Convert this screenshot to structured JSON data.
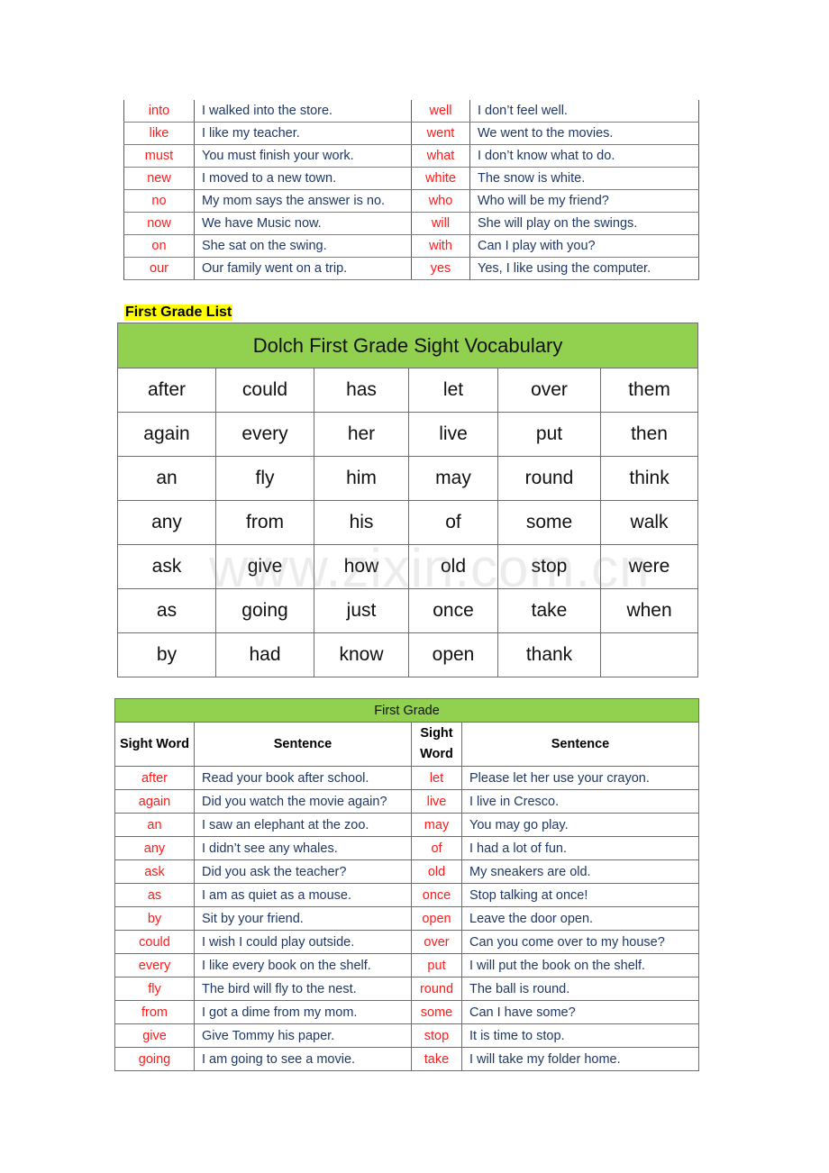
{
  "top_table": {
    "rows": [
      {
        "w1": "into",
        "s1": "I walked into the store.",
        "w2": "well",
        "s2": "I don’t feel well."
      },
      {
        "w1": "like",
        "s1": "I like my teacher.",
        "w2": "went",
        "s2": "We went to the movies."
      },
      {
        "w1": "must",
        "s1": "You must finish your work.",
        "w2": "what",
        "s2": "I don’t know what to do."
      },
      {
        "w1": "new",
        "s1": "I moved to a new town.",
        "w2": "white",
        "s2": "The snow is white."
      },
      {
        "w1": "no",
        "s1": "My mom says the answer is no.",
        "w2": "who",
        "s2": "Who will be my friend?"
      },
      {
        "w1": "now",
        "s1": "We have Music now.",
        "w2": "will",
        "s2": "She will play on the swings."
      },
      {
        "w1": "on",
        "s1": "She sat on the swing.",
        "w2": "with",
        "s2": "Can I play with you?"
      },
      {
        "w1": "our",
        "s1": "Our family went on a trip.",
        "w2": "yes",
        "s2": "Yes, I like using the computer."
      }
    ]
  },
  "heading": "First Grade List",
  "dolch_grid": {
    "title": "Dolch First Grade Sight Vocabulary",
    "rows": [
      [
        "after",
        "could",
        "has",
        "let",
        "over",
        "them"
      ],
      [
        "again",
        "every",
        "her",
        "live",
        "put",
        "then"
      ],
      [
        "an",
        "fly",
        "him",
        "may",
        "round",
        "think"
      ],
      [
        "any",
        "from",
        "his",
        "of",
        "some",
        "walk"
      ],
      [
        "ask",
        "give",
        "how",
        "old",
        "stop",
        "were"
      ],
      [
        "as",
        "going",
        "just",
        "once",
        "take",
        "when"
      ],
      [
        "by",
        "had",
        "know",
        "open",
        "thank",
        ""
      ]
    ]
  },
  "watermark": "www.zixin.com.cn",
  "sentence_table": {
    "title": "First Grade",
    "headers": {
      "word": "Sight Word",
      "sentence": "Sentence"
    },
    "rows": [
      {
        "w1": "after",
        "s1": "Read your book after school.",
        "w2": "let",
        "s2": "Please let her use your crayon."
      },
      {
        "w1": "again",
        "s1": "Did you watch the movie again?",
        "w2": "live",
        "s2": "I live in Cresco."
      },
      {
        "w1": "an",
        "s1": "I saw an elephant at the zoo.",
        "w2": "may",
        "s2": "You may go play."
      },
      {
        "w1": "any",
        "s1": "I didn’t see any whales.",
        "w2": "of",
        "s2": "I had a lot of fun."
      },
      {
        "w1": "ask",
        "s1": "Did you ask the teacher?",
        "w2": "old",
        "s2": "My sneakers are old."
      },
      {
        "w1": "as",
        "s1": "I am as quiet as a mouse.",
        "w2": "once",
        "s2": "Stop talking at once!"
      },
      {
        "w1": "by",
        "s1": "Sit by your friend.",
        "w2": "open",
        "s2": "Leave the door open."
      },
      {
        "w1": "could",
        "s1": "I wish I could play outside.",
        "w2": "over",
        "s2": "Can you come over to my house?"
      },
      {
        "w1": "every",
        "s1": "I like every book on the shelf.",
        "w2": "put",
        "s2": "I will put the book on the shelf."
      },
      {
        "w1": "fly",
        "s1": "The bird will fly to the nest.",
        "w2": "round",
        "s2": "The ball is round."
      },
      {
        "w1": "from",
        "s1": "I got a dime from my mom.",
        "w2": "some",
        "s2": "Can I have some?"
      },
      {
        "w1": "give",
        "s1": "Give Tommy his paper.",
        "w2": "stop",
        "s2": "It is time to stop."
      },
      {
        "w1": "going",
        "s1": "I am going to see a movie.",
        "w2": "take",
        "s2": "I will take my folder home."
      }
    ]
  },
  "colors": {
    "sight_word": "#ff1a1a",
    "sentence": "#1f3864",
    "header_green": "#92d050",
    "highlight_yellow": "#ffff00"
  }
}
